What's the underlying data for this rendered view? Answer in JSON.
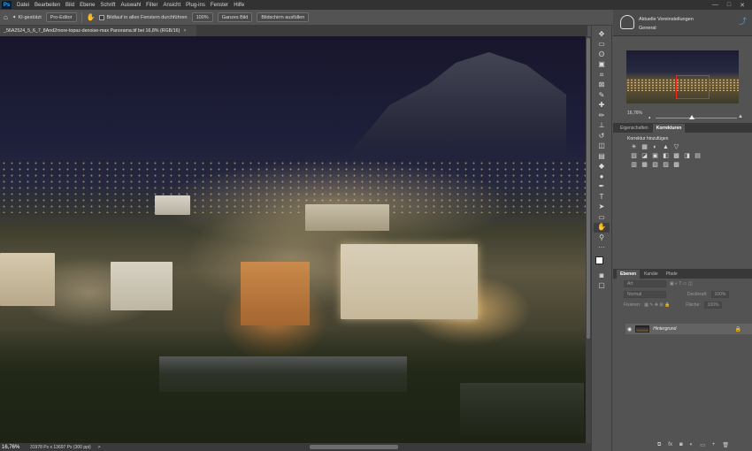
{
  "app": {
    "logo": "Ps",
    "menu": [
      "Datei",
      "Bearbeiten",
      "Bild",
      "Ebene",
      "Schrift",
      "Auswahl",
      "Filter",
      "Ansicht",
      "Plug-ins",
      "Fenster",
      "Hilfe"
    ],
    "window_controls": [
      "—",
      "□",
      "✕"
    ]
  },
  "options_bar": {
    "home_icon": "home-icon",
    "ai_label": "KI-gestützt",
    "pro_editor_label": "Pro-Editor",
    "hand_icon": "hand-icon",
    "scroll_all_label": "Bildlauf in allen Fenstern durchführen",
    "zoom_100": "100%",
    "fit_screen": "Ganzes Bild",
    "fill_screen": "Bildschirm ausfüllen"
  },
  "document": {
    "tab_title": "_56A2524_5_6_7_8And2more-topaz-denoise-max Panorama.tif bei 16,8% (RGB/16)",
    "close": "×"
  },
  "status": {
    "zoom": "16,76%",
    "dimensions": "31978 Px x 13697 Px (300 ppi)",
    "arrow": ">"
  },
  "toolbar": {
    "tools": [
      {
        "name": "move-tool",
        "glyph": "✥"
      },
      {
        "name": "artboard-tool",
        "glyph": "▭"
      },
      {
        "name": "lasso-tool",
        "glyph": "ʘ"
      },
      {
        "name": "object-select-tool",
        "glyph": "▣"
      },
      {
        "name": "crop-tool",
        "glyph": "⌗"
      },
      {
        "name": "frame-tool",
        "glyph": "⊠"
      },
      {
        "name": "eyedropper-tool",
        "glyph": "✎"
      },
      {
        "name": "spot-heal-tool",
        "glyph": "✚"
      },
      {
        "name": "brush-tool",
        "glyph": "✏"
      },
      {
        "name": "stamp-tool",
        "glyph": "⊥"
      },
      {
        "name": "history-brush-tool",
        "glyph": "↺"
      },
      {
        "name": "eraser-tool",
        "glyph": "◫"
      },
      {
        "name": "gradient-tool",
        "glyph": "▤"
      },
      {
        "name": "blur-tool",
        "glyph": "◆"
      },
      {
        "name": "dodge-tool",
        "glyph": "●"
      },
      {
        "name": "pen-tool",
        "glyph": "✒"
      },
      {
        "name": "type-tool",
        "glyph": "T"
      },
      {
        "name": "path-select-tool",
        "glyph": "➤"
      },
      {
        "name": "rectangle-tool",
        "glyph": "▭"
      },
      {
        "name": "hand-tool",
        "glyph": "✋"
      },
      {
        "name": "zoom-tool",
        "glyph": "⚲"
      },
      {
        "name": "more-tools",
        "glyph": "···"
      }
    ],
    "extra": [
      {
        "name": "quick-mask-icon",
        "glyph": "◙"
      },
      {
        "name": "screen-mode-icon",
        "glyph": "▢"
      }
    ]
  },
  "learn": {
    "title": "Aktuelle Voreinstellungen",
    "subtitle": "General"
  },
  "navigator": {
    "zoom": "16,76%"
  },
  "panels": {
    "tabs1": [
      "Eigenschaften",
      "Korrekturen"
    ],
    "active1": "Korrekturen",
    "add_adjustment": "Korrektur hinzufügen",
    "tabs2": [
      "Ebenen",
      "Kanäle",
      "Pfade"
    ],
    "active2": "Ebenen"
  },
  "adjustments": {
    "row1": [
      "☀",
      "▦",
      "◐",
      "▲",
      "▽"
    ],
    "row2": [
      "▨",
      "◪",
      "▣",
      "◧",
      "▩",
      "◨",
      "▤"
    ],
    "row3": [
      "▥",
      "▦",
      "▧",
      "▨",
      "▩"
    ]
  },
  "layers": {
    "filter_placeholder": "Art",
    "blend_mode": "Normal",
    "opacity_label": "Deckkraft:",
    "opacity_value": "100%",
    "lock_label": "Fixieren:",
    "fill_label": "Fläche:",
    "fill_value": "100%",
    "layer_name": "Hintergrund",
    "bottom_icons": [
      "⧉",
      "fx",
      "◙",
      "◐",
      "▭",
      "+",
      "🗑"
    ]
  }
}
